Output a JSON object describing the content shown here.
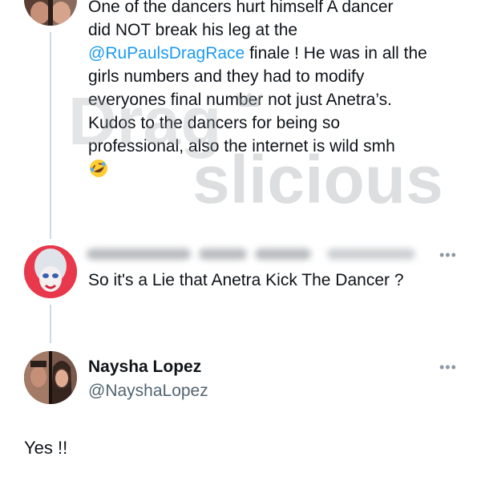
{
  "thread": {
    "tweet_lines": [
      "One of the dancers hurt himself A dancer",
      "did NOT break his leg at the",
      "finale ! He was in all the",
      "girls numbers and they had to modify",
      "everyones final number not just Anetra’s.",
      "Kudos to the dancers for being so",
      "professional, also the internet is wild smh"
    ],
    "mention": "@RuPaulsDragRace",
    "emoji": "rolling-on-floor-laughing-emoji"
  },
  "watermark": {
    "line1": "Drag",
    "line2": "slicious"
  },
  "reply": {
    "text": "So it's a Lie that Anetra Kick The Dancer ?",
    "more_label": "•••"
  },
  "author": {
    "name": "Naysha Lopez",
    "handle": "@NayshaLopez",
    "more_label": "•••"
  },
  "final_reply": {
    "text": "Yes !!"
  },
  "colors": {
    "link": "#1d9bf0",
    "text": "#0f1419",
    "secondary": "#536471",
    "thread_line": "#cfd9de"
  }
}
